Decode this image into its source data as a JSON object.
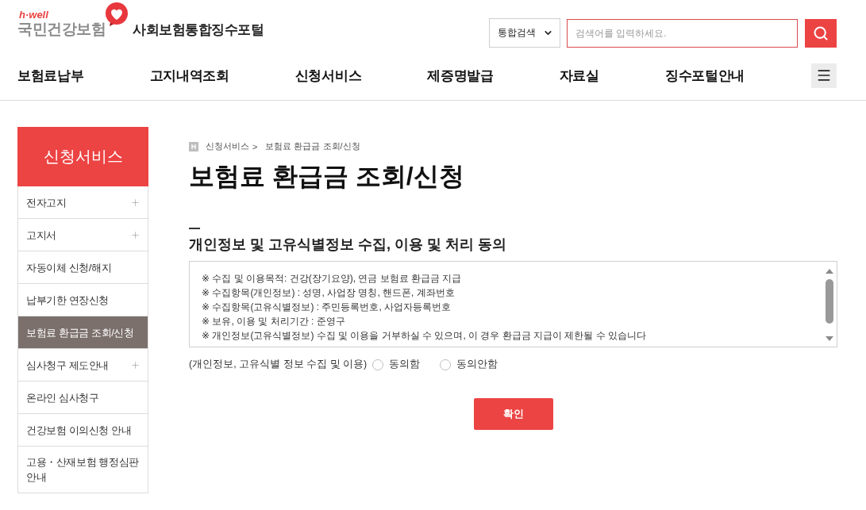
{
  "header": {
    "logo": {
      "tagline": "h·well",
      "name": "국민건강보험"
    },
    "portal_title": "사회보험통합징수포털",
    "search": {
      "scope": "통합검색",
      "placeholder": "검색어를 입력하세요."
    }
  },
  "nav": [
    "보험료납부",
    "고지내역조회",
    "신청서비스",
    "제증명발급",
    "자료실",
    "징수포털안내"
  ],
  "sidebar": {
    "title": "신청서비스",
    "items": [
      {
        "label": "전자고지",
        "has_submenu": true,
        "selected": false
      },
      {
        "label": "고지서",
        "has_submenu": true,
        "selected": false
      },
      {
        "label": "자동이체 신청/해지",
        "has_submenu": false,
        "selected": false
      },
      {
        "label": "납부기한 연장신청",
        "has_submenu": false,
        "selected": false
      },
      {
        "label": "보험료 환급금 조회/신청",
        "has_submenu": false,
        "selected": true
      },
      {
        "label": "심사청구 제도안내",
        "has_submenu": true,
        "selected": false
      },
      {
        "label": "온라인 심사청구",
        "has_submenu": false,
        "selected": false
      },
      {
        "label": "건강보험 이의신청 안내",
        "has_submenu": false,
        "selected": false
      },
      {
        "label": "고용・산재보험 행정심판 안내",
        "has_submenu": false,
        "selected": false
      }
    ]
  },
  "breadcrumb": {
    "home": "H",
    "items": [
      "신청서비스",
      "보험료 환급금 조회/신청"
    ],
    "separator": ">"
  },
  "page_title": "보험료 환급금 조회/신청",
  "consent": {
    "title": "개인정보 및 고유식별정보 수집, 이용 및 처리 동의",
    "lines": [
      "※ 수집 및 이용목적: 건강(장기요양), 연금 보험료 환급금 지급",
      "※ 수집항목(개인정보) : 성명, 사업장 명칭, 핸드폰, 계좌번호",
      "※ 수집항목(고유식별정보) : 주민등록번호, 사업자등록번호",
      "※ 보유, 이용 및 처리기간 : 준영구",
      "※ 개인정보(고유식별정보) 수집 및 이용을 거부하실 수 있으며, 이 경우 환급금 지급이 제한될 수 있습니다"
    ],
    "question": "(개인정보, 고유식별 정보 수집 및 이용)",
    "options": [
      {
        "label": "동의함",
        "selected": false
      },
      {
        "label": "동의안함",
        "selected": false
      }
    ]
  },
  "confirm_button": "확인"
}
